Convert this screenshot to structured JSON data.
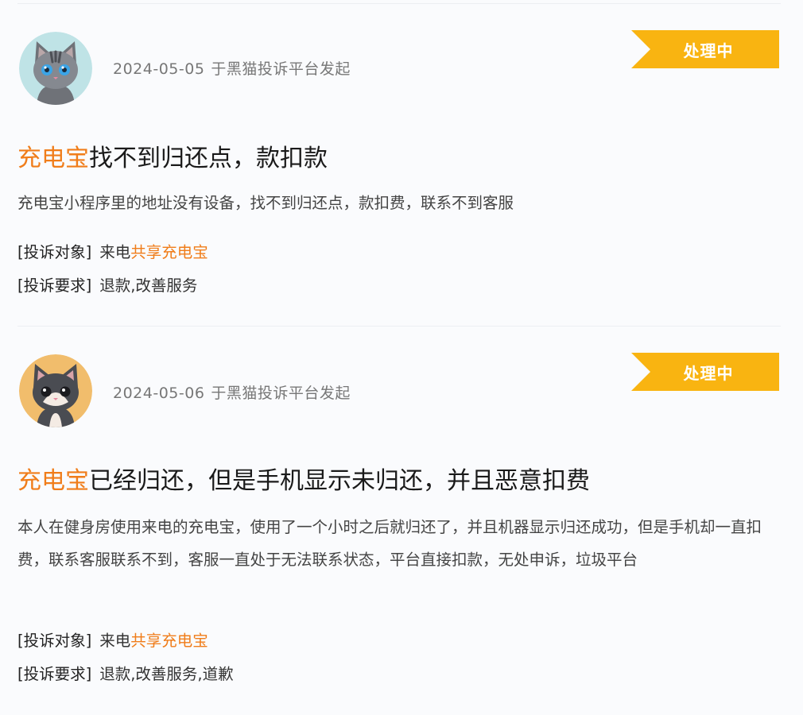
{
  "complaints": [
    {
      "date": "2024-05-05",
      "source": "于黑猫投诉平台发起",
      "status": "处理中",
      "title_keyword": "充电宝",
      "title_rest": "找不到归还点，款扣款",
      "description": "充电宝小程序里的地址没有设备，找不到归还点，款扣费，联系不到客服",
      "target_label": "[投诉对象]",
      "target_prefix": "来电",
      "target_highlight": "共享充电宝",
      "request_label": "[投诉要求]",
      "request_value": "退款,改善服务",
      "avatar": "gray-cat-avatar"
    },
    {
      "date": "2024-05-06",
      "source": "于黑猫投诉平台发起",
      "status": "处理中",
      "title_keyword": "充电宝",
      "title_rest": "已经归还，但是手机显示未归还，并且恶意扣费",
      "description": "本人在健身房使用来电的充电宝，使用了一个小时之后就归还了，并且机器显示归还成功，但是手机却一直扣费，联系客服联系不到，客服一直处于无法联系状态，平台直接扣款，无处申诉，垃圾平台",
      "target_label": "[投诉对象]",
      "target_prefix": "来电",
      "target_highlight": "共享充电宝",
      "request_label": "[投诉要求]",
      "request_value": "退款,改善服务,道歉",
      "avatar": "tuxedo-cat-avatar"
    }
  ],
  "colors": {
    "accent": "#f07d1a",
    "badge": "#f9b411"
  }
}
